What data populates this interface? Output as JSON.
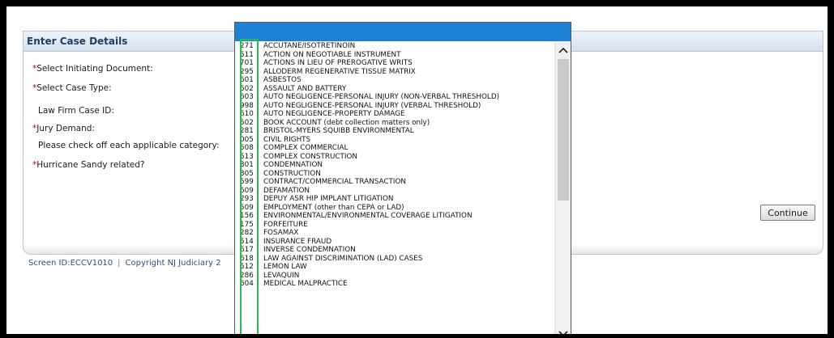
{
  "panel": {
    "title": "Enter Case Details",
    "fields": [
      {
        "required": true,
        "label": "Select Initiating Document:"
      },
      {
        "required": true,
        "label": "Select Case Type:"
      },
      {
        "required": false,
        "label": "Law Firm Case ID:"
      },
      {
        "required": true,
        "label": "Jury Demand:"
      },
      {
        "required": false,
        "label": "Please check off each applicable category:"
      },
      {
        "required": true,
        "label": "Hurricane Sandy related?"
      }
    ],
    "required_marker": "*",
    "continue_label": "Continue"
  },
  "footer": {
    "screen_id": "Screen ID:ECCV1010",
    "separator": "|",
    "copyright": "Copyright NJ Judiciary 2"
  },
  "case_type_dropdown": {
    "items": [
      {
        "code": "271",
        "label": "ACCUTANE/ISOTRETINOIN"
      },
      {
        "code": "511",
        "label": "ACTION ON NEGOTIABLE INSTRUMENT"
      },
      {
        "code": "701",
        "label": "ACTIONS IN LIEU OF PREROGATIVE WRITS"
      },
      {
        "code": "295",
        "label": "ALLODERM REGENERATIVE TISSUE MATRIX"
      },
      {
        "code": "601",
        "label": "ASBESTOS"
      },
      {
        "code": "602",
        "label": "ASSAULT AND BATTERY"
      },
      {
        "code": "603",
        "label": "AUTO NEGLIGENCE-PERSONAL INJURY (NON-VERBAL THRESHOLD)"
      },
      {
        "code": "998",
        "label": "AUTO NEGLIGENCE-PERSONAL INJURY (VERBAL THRESHOLD)"
      },
      {
        "code": "610",
        "label": "AUTO NEGLIGENCE-PROPERTY DAMAGE"
      },
      {
        "code": "502",
        "label": "BOOK ACCOUNT (debt collection matters only)"
      },
      {
        "code": "281",
        "label": "BRISTOL-MYERS SQUIBB ENVIRONMENTAL"
      },
      {
        "code": "005",
        "label": "CIVIL RIGHTS"
      },
      {
        "code": "508",
        "label": "COMPLEX COMMERCIAL"
      },
      {
        "code": "513",
        "label": "COMPLEX CONSTRUCTION"
      },
      {
        "code": "301",
        "label": "CONDEMNATION"
      },
      {
        "code": "305",
        "label": "CONSTRUCTION"
      },
      {
        "code": "599",
        "label": "CONTRACT/COMMERCIAL TRANSACTION"
      },
      {
        "code": "609",
        "label": "DEFAMATION"
      },
      {
        "code": "293",
        "label": "DEPUY ASR HIP IMPLANT LITIGATION"
      },
      {
        "code": "509",
        "label": "EMPLOYMENT (other than CEPA or LAD)"
      },
      {
        "code": "156",
        "label": "ENVIRONMENTAL/ENVIRONMENTAL COVERAGE LITIGATION"
      },
      {
        "code": "175",
        "label": "FORFEITURE"
      },
      {
        "code": "282",
        "label": "FOSAMAX"
      },
      {
        "code": "514",
        "label": "INSURANCE FRAUD"
      },
      {
        "code": "617",
        "label": "INVERSE CONDEMNATION"
      },
      {
        "code": "618",
        "label": "LAW AGAINST DISCRIMINATION (LAD) CASES"
      },
      {
        "code": "512",
        "label": "LEMON LAW"
      },
      {
        "code": "286",
        "label": "LEVAQUIN"
      },
      {
        "code": "604",
        "label": "MEDICAL MALPRACTICE"
      }
    ],
    "scroll_up_icon": "chevron-up-icon",
    "scroll_down_icon": "chevron-down-icon"
  },
  "colors": {
    "selected_bar": "#1e7fd6",
    "highlight_box": "#22c04a",
    "header_text": "#1f3d66",
    "required_marker": "#cc0000"
  }
}
